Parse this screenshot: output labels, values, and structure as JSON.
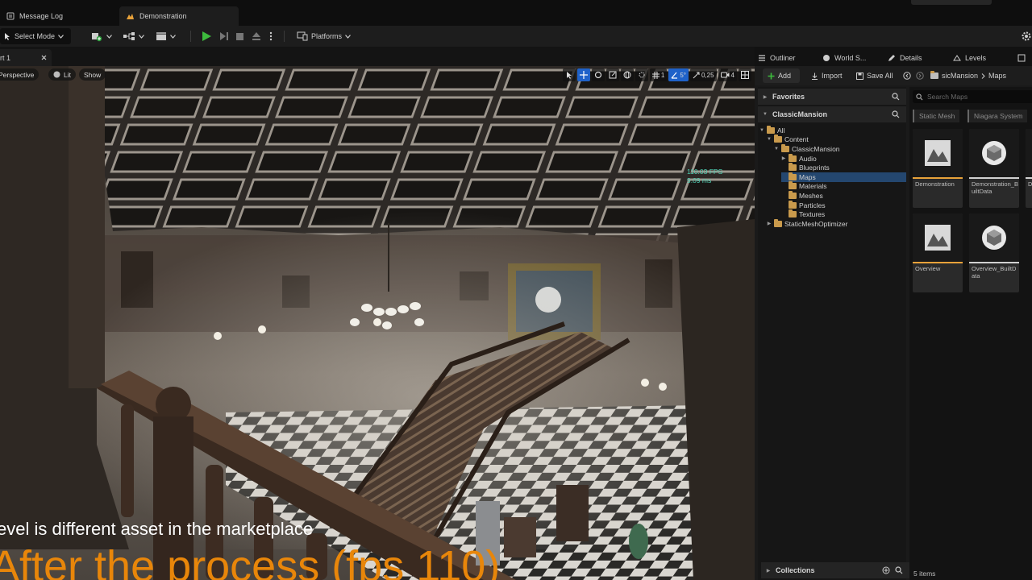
{
  "tabs": [
    {
      "label": "Message Log",
      "active": false
    },
    {
      "label": "Demonstration",
      "active": true
    }
  ],
  "toolbar": {
    "select_mode": "Select Mode",
    "platforms": "Platforms"
  },
  "viewport": {
    "tab_label": "rt 1",
    "perspective": "Perspective",
    "lit": "Lit",
    "show": "Show",
    "rotation_snap": "5°",
    "scale_snap": "0,25",
    "grid_snap": "1",
    "camera_speed": "4",
    "fps": "110.03 FPS",
    "ms": "9.09 ms"
  },
  "captions": {
    "line1": "evel is different asset in the marketplace",
    "line2": "After the process (fps 110)"
  },
  "panel_tabs": [
    "Outliner",
    "World S...",
    "Details",
    "Levels"
  ],
  "content_browser": {
    "add": "Add",
    "import": "Import",
    "save_all": "Save All",
    "breadcrumb_1": "sicMansion",
    "breadcrumb_2": "Maps",
    "favorites": "Favorites",
    "root_section": "ClassicMansion",
    "tree": [
      {
        "label": "All",
        "depth": 0,
        "open": true
      },
      {
        "label": "Content",
        "depth": 1,
        "open": true
      },
      {
        "label": "ClassicMansion",
        "depth": 2,
        "open": true
      },
      {
        "label": "Audio",
        "depth": 3,
        "open": false
      },
      {
        "label": "Blueprints",
        "depth": 3,
        "open": null
      },
      {
        "label": "Maps",
        "depth": 3,
        "open": null,
        "selected": true
      },
      {
        "label": "Materials",
        "depth": 3,
        "open": null
      },
      {
        "label": "Meshes",
        "depth": 3,
        "open": null
      },
      {
        "label": "Particles",
        "depth": 3,
        "open": null
      },
      {
        "label": "Textures",
        "depth": 3,
        "open": null
      },
      {
        "label": "StaticMeshOptimizer",
        "depth": 1,
        "open": false
      }
    ],
    "search_placeholder": "Search Maps",
    "filters": [
      "Static Mesh",
      "Niagara System"
    ],
    "assets": [
      {
        "label": "Demonstration",
        "kind": "map",
        "bar_color": "#e8a23a"
      },
      {
        "label": "Demonstration_BuiltData",
        "kind": "data",
        "bar_color": "#d0d0d0"
      },
      {
        "label": "D...",
        "kind": "partial",
        "bar_color": "#d0d0d0"
      },
      {
        "label": "Overview",
        "kind": "map",
        "bar_color": "#e8a23a"
      },
      {
        "label": "Overview_BuiltData",
        "kind": "data",
        "bar_color": "#d0d0d0"
      }
    ],
    "items_count": "5 items",
    "collections": "Collections"
  },
  "colors": {
    "accent": "#1f62c9",
    "caption_orange": "#e8860a",
    "fps_green": "#4fd0b4",
    "folder": "#c99a4c"
  }
}
